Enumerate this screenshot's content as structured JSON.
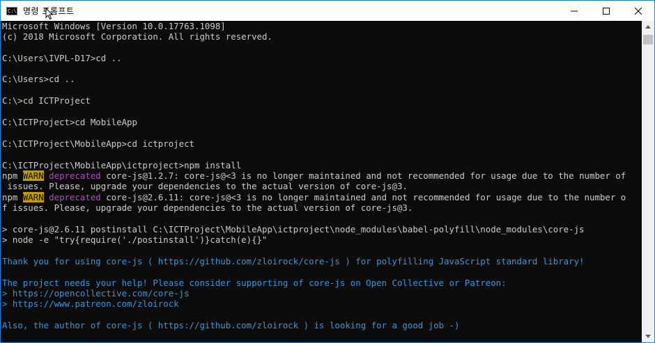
{
  "window": {
    "title": "명령 프롬프트",
    "icon": "cmd-icon",
    "accent": "#1883d7"
  },
  "controls": {
    "minimize": "minimize-icon",
    "maximize": "maximize-icon",
    "close": "close-icon"
  },
  "colors": {
    "background": "#0c0c0c",
    "text": "#cccccc",
    "warn_bg": "#c19c00",
    "deprecated": "#b148c6",
    "cyan": "#3a96dd"
  },
  "console": {
    "l1": "Microsoft Windows [Version 10.0.17763.1098]",
    "l2": "(c) 2018 Microsoft Corporation. All rights reserved.",
    "l3": "C:\\Users\\IVPL-D17>cd ..",
    "l4": "C:\\Users>cd ..",
    "l5": "C:\\>cd ICTProject",
    "l6": "C:\\ICTProject>cd MobileApp",
    "l7": "C:\\ICTProject\\MobileApp>cd ictproject",
    "l8": "C:\\ICTProject\\MobileApp\\ictproject>npm install",
    "l9": {
      "npm": "npm ",
      "warn": "WARN",
      "depr": "deprecated",
      "rest": " core-js@1.2.7: core-js@<3 is no longer maintained and not recommended for usage due to the number of"
    },
    "l10": " issues. Please, upgrade your dependencies to the actual version of core-js@3.",
    "l11": {
      "npm": "npm ",
      "warn": "WARN",
      "depr": "deprecated",
      "rest": " core-js@2.6.11: core-js@<3 is no longer maintained and not recommended for usage due to the number o"
    },
    "l12": "f issues. Please, upgrade your dependencies to the actual version of core-js@3.",
    "l13": "> core-js@2.6.11 postinstall C:\\ICTProject\\MobileApp\\ictproject\\node_modules\\babel-polyfill\\node_modules\\core-js",
    "l14": "> node -e \"try{require('./postinstall')}catch(e){}\"",
    "l15": "Thank you for using core-js ( https://github.com/zloirock/core-js ) for polyfilling JavaScript standard library!",
    "l16": "The project needs your help! Please consider supporting of core-js on Open Collective or Patreon:",
    "l17": {
      "prefix": "> ",
      "url": "https://opencollective.com/core-js"
    },
    "l18": {
      "prefix": "> ",
      "url": "https://www.patreon.com/zloirock"
    },
    "l19": "Also, the author of core-js ( https://github.com/zloirock ) is looking for a good job -)"
  },
  "scrollbar": {
    "up": "scroll-up-arrow-icon",
    "down": "scroll-down-arrow-icon"
  }
}
